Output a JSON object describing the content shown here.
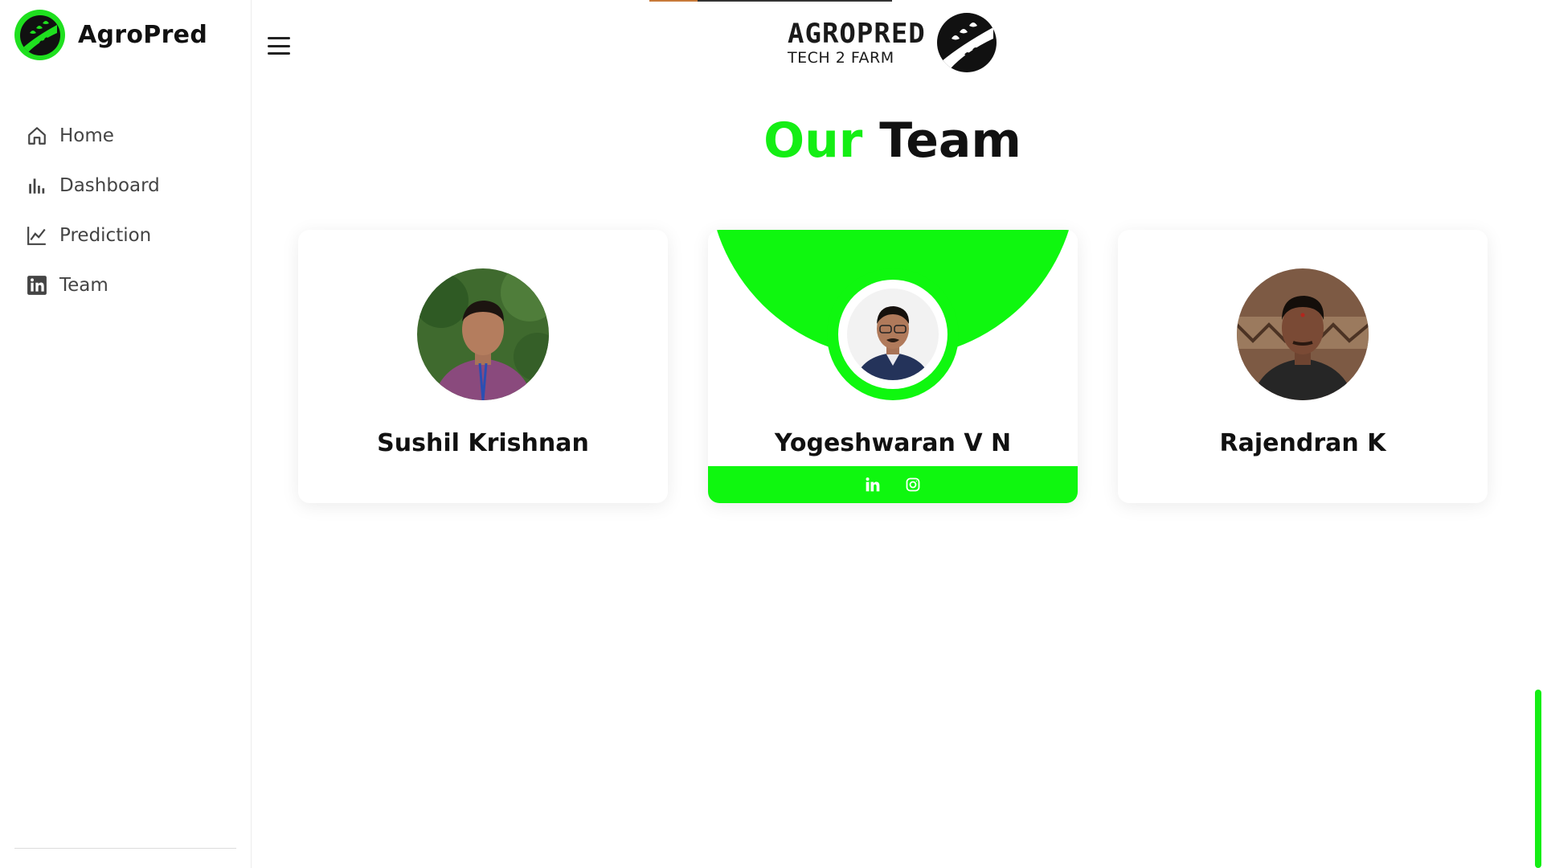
{
  "brand": {
    "name": "AgroPred",
    "accent": "#14ee14"
  },
  "sidebar": {
    "items": [
      {
        "label": "Home",
        "icon": "home-icon"
      },
      {
        "label": "Dashboard",
        "icon": "bar-chart-icon"
      },
      {
        "label": "Prediction",
        "icon": "line-chart-icon"
      },
      {
        "label": "Team",
        "icon": "linkedin-icon"
      }
    ]
  },
  "header": {
    "logo_title": "AGROPRED",
    "logo_sub": "TECH 2 FARM"
  },
  "section": {
    "title_accent": "Our",
    "title_rest": "Team"
  },
  "team": [
    {
      "name": "Sushil Krishnan"
    },
    {
      "name": "Yogeshwaran V N",
      "social": [
        "linkedin-icon",
        "instagram-icon"
      ]
    },
    {
      "name": "Rajendran K"
    }
  ]
}
